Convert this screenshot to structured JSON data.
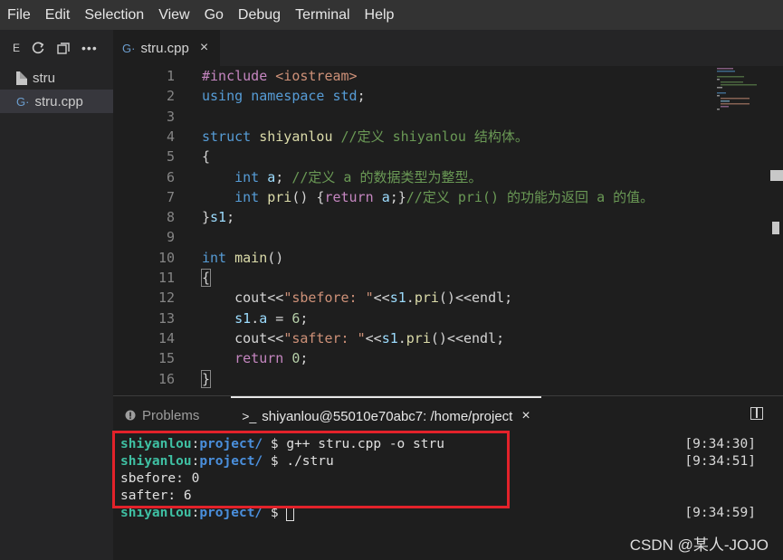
{
  "menu": [
    "File",
    "Edit",
    "Selection",
    "View",
    "Go",
    "Debug",
    "Terminal",
    "Help"
  ],
  "sidebar": {
    "toolbar_label": "E",
    "files": [
      {
        "name": "stru",
        "icon": "file-icon"
      },
      {
        "name": "stru.cpp",
        "icon": "cpp-file-icon",
        "active": true
      }
    ]
  },
  "tab": {
    "label": "stru.cpp",
    "close": "×"
  },
  "code": [
    {
      "n": "1",
      "text": "#include <iostream>"
    },
    {
      "n": "2",
      "text": "using namespace std;"
    },
    {
      "n": "3",
      "text": ""
    },
    {
      "n": "4",
      "text": "struct shiyanlou //定义 shiyanlou 结构体。"
    },
    {
      "n": "5",
      "text": "{"
    },
    {
      "n": "6",
      "text": "    int a; //定义 a 的数据类型为整型。"
    },
    {
      "n": "7",
      "text": "    int pri() {return a;}//定义 pri() 的功能为返回 a 的值。"
    },
    {
      "n": "8",
      "text": "}s1;"
    },
    {
      "n": "9",
      "text": ""
    },
    {
      "n": "10",
      "text": "int main()"
    },
    {
      "n": "11",
      "text": "{"
    },
    {
      "n": "12",
      "text": "    cout<<\"sbefore: \"<<s1.pri()<<endl;"
    },
    {
      "n": "13",
      "text": "    s1.a = 6;"
    },
    {
      "n": "14",
      "text": "    cout<<\"safter: \"<<s1.pri()<<endl;"
    },
    {
      "n": "15",
      "text": "    return 0;"
    },
    {
      "n": "16",
      "text": "}"
    }
  ],
  "panel": {
    "problems_label": "Problems",
    "terminal_label": "shiyanlou@55010e70abc7: /home/project",
    "terminal_close": "×"
  },
  "terminal": {
    "lines": [
      {
        "user": "shiyanlou",
        "dir": "project/",
        "cmd": " $ g++ stru.cpp -o stru",
        "time": "[9:34:30]"
      },
      {
        "user": "shiyanlou",
        "dir": "project/",
        "cmd": " $ ./stru",
        "time": "[9:34:51]"
      },
      {
        "output": "sbefore: 0"
      },
      {
        "output": "safter: 6"
      },
      {
        "user": "shiyanlou",
        "dir": "project/",
        "cmd": " $ ",
        "time": "[9:34:59]",
        "cursor": true
      }
    ]
  },
  "watermark": "CSDN @某人-JOJO"
}
